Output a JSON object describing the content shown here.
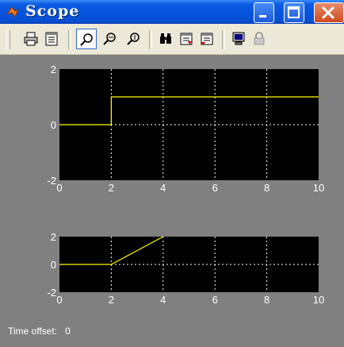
{
  "window": {
    "title": "Scope",
    "icon": "matlab-icon",
    "buttons": [
      "minimize-button",
      "maximize-button",
      "close-button"
    ]
  },
  "toolbar": {
    "tools": [
      {
        "name": "print-button",
        "icon": "printer-icon"
      },
      {
        "name": "parameters-button",
        "icon": "parameters-icon"
      },
      {
        "name": "zoom-button",
        "icon": "zoom-icon",
        "pressed": true
      },
      {
        "name": "zoom-x-button",
        "icon": "zoom-x-icon"
      },
      {
        "name": "zoom-y-button",
        "icon": "zoom-y-icon"
      },
      {
        "name": "autoscale-button",
        "icon": "binoculars-icon"
      },
      {
        "name": "save-axes-button",
        "icon": "save-axes-icon"
      },
      {
        "name": "restore-axes-button",
        "icon": "restore-axes-icon"
      },
      {
        "name": "floating-scope-button",
        "icon": "monitor-icon"
      },
      {
        "name": "lock-axes-button",
        "icon": "lock-icon"
      }
    ]
  },
  "status": {
    "label": "Time offset:",
    "value": "0"
  },
  "colors": {
    "plot_background": "#000000",
    "figure_background": "#808080",
    "signal": "#ffff00",
    "axis_text": "#ffffff"
  },
  "chart_data": [
    {
      "type": "line",
      "x": [
        0,
        2,
        2,
        10
      ],
      "y": [
        0,
        0,
        1,
        1
      ],
      "xlim": [
        0,
        10
      ],
      "ylim": [
        -2,
        2
      ],
      "xticks": [
        "0",
        "2",
        "4",
        "6",
        "8",
        "10"
      ],
      "yticks": [
        "2",
        "0",
        "-2"
      ],
      "grid": true
    },
    {
      "type": "line",
      "x": [
        0,
        2,
        4
      ],
      "y": [
        0,
        0,
        2
      ],
      "xlim": [
        0,
        10
      ],
      "ylim": [
        -2,
        2
      ],
      "xticks": [
        "0",
        "2",
        "4",
        "6",
        "8",
        "10"
      ],
      "yticks": [
        "2",
        "0",
        "-2"
      ],
      "grid": true
    }
  ]
}
